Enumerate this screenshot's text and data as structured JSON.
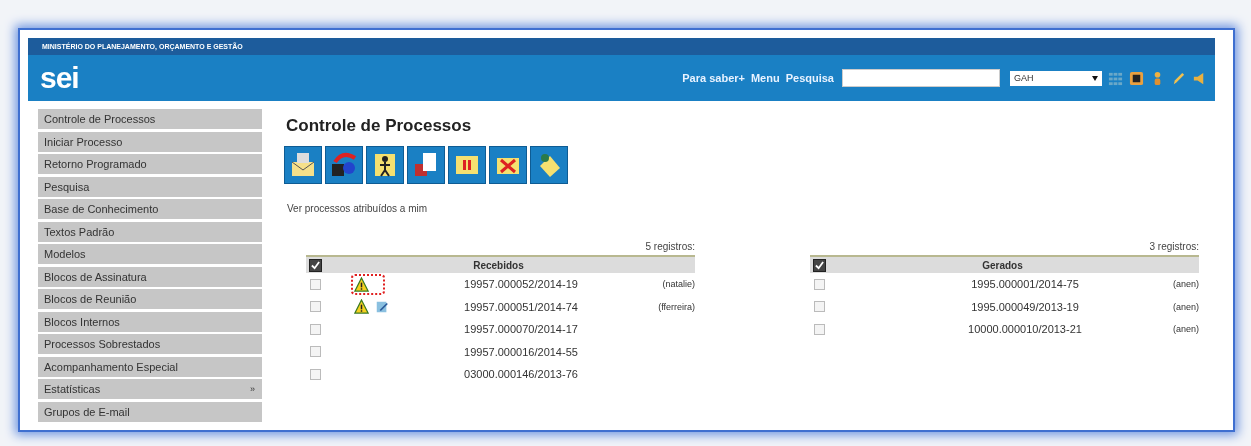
{
  "header": {
    "ministry": "MINISTÉRIO DO PLANEJAMENTO, ORÇAMENTO E GESTÃO",
    "logo": "sei",
    "links": [
      "Para saber+",
      "Menu",
      "Pesquisa"
    ],
    "unit_select": {
      "value": "GAH"
    }
  },
  "sidebar": {
    "items": [
      {
        "label": "Controle de Processos"
      },
      {
        "label": "Iniciar Processo"
      },
      {
        "label": "Retorno Programado"
      },
      {
        "label": "Pesquisa"
      },
      {
        "label": "Base de Conhecimento"
      },
      {
        "label": "Textos Padrão"
      },
      {
        "label": "Modelos"
      },
      {
        "label": "Blocos de Assinatura"
      },
      {
        "label": "Blocos de Reunião"
      },
      {
        "label": "Blocos Internos"
      },
      {
        "label": "Processos Sobrestados"
      },
      {
        "label": "Acompanhamento Especial"
      },
      {
        "label": "Estatísticas",
        "submenu": "»"
      },
      {
        "label": "Grupos de E-mail"
      }
    ]
  },
  "page": {
    "title": "Controle de Processos",
    "assigned_link": "Ver processos atribuídos a mim"
  },
  "tables": [
    {
      "count": "5 registros:",
      "heading": "Recebidos",
      "all_checked": true,
      "rows": [
        {
          "checked": false,
          "highlighted": true,
          "warning": true,
          "note": false,
          "number": "19957.000052/2014-19",
          "user": "(natalie)"
        },
        {
          "checked": false,
          "highlighted": false,
          "warning": true,
          "note": true,
          "number": "19957.000051/2014-74",
          "user": "(fferreira)"
        },
        {
          "checked": false,
          "highlighted": false,
          "warning": false,
          "note": false,
          "number": "19957.000070/2014-17"
        },
        {
          "checked": false,
          "highlighted": false,
          "warning": false,
          "note": false,
          "number": "19957.000016/2014-55"
        },
        {
          "checked": false,
          "highlighted": false,
          "warning": false,
          "note": false,
          "number": "03000.000146/2013-76"
        }
      ]
    },
    {
      "count": "3 registros:",
      "heading": "Gerados",
      "all_checked": true,
      "rows": [
        {
          "checked": false,
          "highlighted": false,
          "warning": false,
          "note": false,
          "number": "1995.000001/2014-75",
          "user": "(anen)"
        },
        {
          "checked": false,
          "highlighted": false,
          "warning": false,
          "note": false,
          "number": "1995.000049/2013-19",
          "user": "(anen)"
        },
        {
          "checked": false,
          "highlighted": false,
          "warning": false,
          "note": false,
          "number": "10000.000010/2013-21",
          "user": "(anen)"
        }
      ]
    }
  ]
}
